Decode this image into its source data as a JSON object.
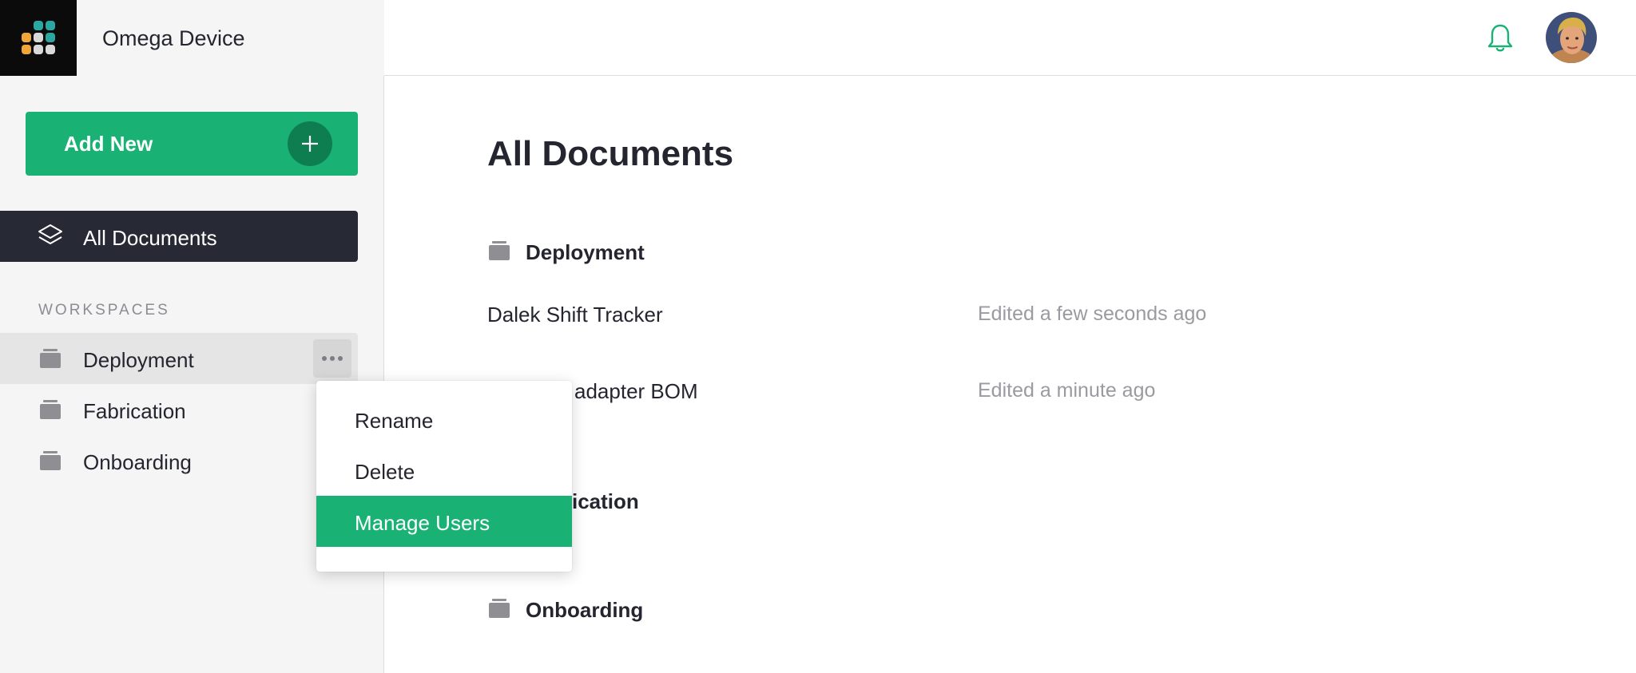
{
  "app": {
    "title": "Omega Device"
  },
  "sidebar": {
    "add_new_label": "Add New",
    "all_documents_label": "All Documents",
    "section_label": "WORKSPACES",
    "workspaces": [
      {
        "label": "Deployment",
        "selected": true
      },
      {
        "label": "Fabrication",
        "selected": false
      },
      {
        "label": "Onboarding",
        "selected": false
      }
    ]
  },
  "header": {
    "notification_icon": "bell-icon",
    "avatar": "user-avatar"
  },
  "main": {
    "title": "All Documents",
    "groups": [
      {
        "name": "Deployment",
        "documents": [
          {
            "name": "Dalek Shift Tracker",
            "edited": "Edited a few seconds ago"
          },
          {
            "name": "adapter BOM",
            "edited": "Edited a minute ago"
          }
        ]
      },
      {
        "name": "ication",
        "documents": []
      },
      {
        "name": "Onboarding",
        "documents": []
      }
    ]
  },
  "context_menu": {
    "items": [
      {
        "label": "Rename",
        "active": false
      },
      {
        "label": "Delete",
        "active": false
      },
      {
        "label": "Manage Users",
        "active": true
      }
    ]
  },
  "colors": {
    "accent": "#19b274",
    "accent_dark": "#0e7e51",
    "nav_active": "#272a35",
    "sidebar_bg": "#f5f5f5"
  }
}
